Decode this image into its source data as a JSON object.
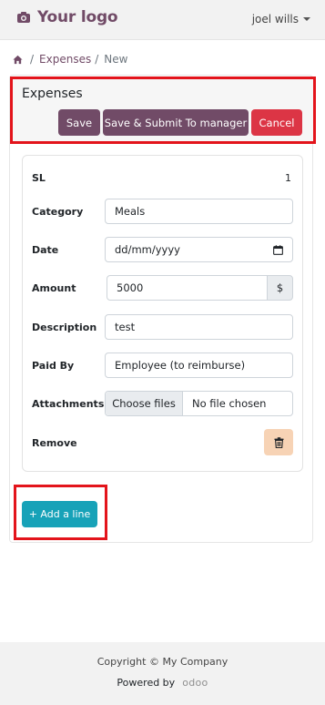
{
  "header": {
    "logo_text": "Your logo",
    "user_name": "joel wills"
  },
  "breadcrumb": {
    "separator": "/",
    "parent": "Expenses",
    "divider": "/",
    "current": "New"
  },
  "expense_form": {
    "title": "Expenses",
    "buttons": {
      "save": "Save",
      "submit": "Save & Submit To manager",
      "cancel": "Cancel"
    }
  },
  "line": {
    "sl_label": "SL",
    "sl_value": "1",
    "category_label": "Category",
    "category_value": "Meals",
    "date_label": "Date",
    "date_placeholder": "dd/mm/yyyy",
    "amount_label": "Amount",
    "amount_value": "5000",
    "currency": "$",
    "description_label": "Description",
    "description_value": "test",
    "paid_by_label": "Paid By",
    "paid_by_value": "Employee (to reimburse)",
    "attachments_label": "Attachments",
    "choose_files": "Choose files",
    "no_file": "No file chosen",
    "remove_label": "Remove"
  },
  "add_line_label": "+ Add a line",
  "footer": {
    "copyright": "Copyright © My Company",
    "powered_by": "Powered by",
    "brand": "odoo"
  },
  "colors": {
    "primary": "#714b67",
    "danger": "#dc3545",
    "info": "#17a2b8",
    "highlight": "#e3141b",
    "warning_light": "#f7d3b5"
  },
  "icons": {
    "logo": "camera-icon",
    "home": "home-icon",
    "date": "calendar-icon",
    "remove": "trash-icon",
    "user_menu": "caret-down-icon"
  }
}
